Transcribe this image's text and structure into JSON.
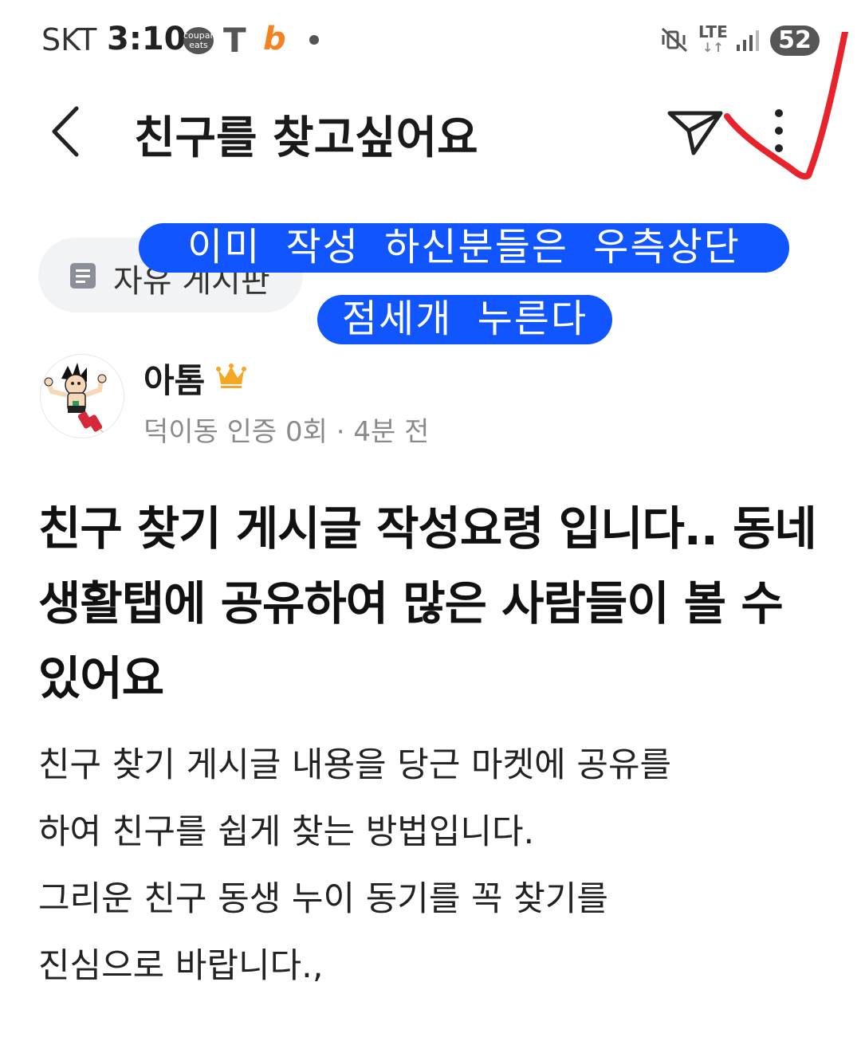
{
  "status_bar": {
    "carrier": "SKT",
    "time": "3:10",
    "coupang_eats": "coupang eats",
    "t_app": "T",
    "b_app": "b",
    "network": "LTE",
    "battery": "52"
  },
  "header": {
    "title": "친구를 찾고싶어요"
  },
  "category": {
    "label": "자유 게시판"
  },
  "annotations": {
    "line1": "이미 작성 하신분들은 우측상단",
    "line2": "점세개 누른다"
  },
  "author": {
    "name": "아톰",
    "meta": "덕이동 인증 0회 · 4분 전"
  },
  "post": {
    "title": "친구 찾기 게시글 작성요령 입니다.. 동네 생활탭에 공유하여 많은 사람들이 볼 수 있어요",
    "body_lines": [
      "친구 찾기 게시글 내용을 당근 마켓에 공유를",
      "하여 친구를 쉽게 찾는 방법입니다.",
      "그리운 친구 동생 누이 동기를 꼭 찾기를",
      "진심으로 바랍니다.,"
    ]
  },
  "colors": {
    "annotation_blue": "#1155ff",
    "check_red": "#e8232b",
    "crown": "#f5a623"
  },
  "icons": [
    "back-arrow-icon",
    "send-icon",
    "more-vertical-icon",
    "board-icon",
    "crown-icon"
  ]
}
